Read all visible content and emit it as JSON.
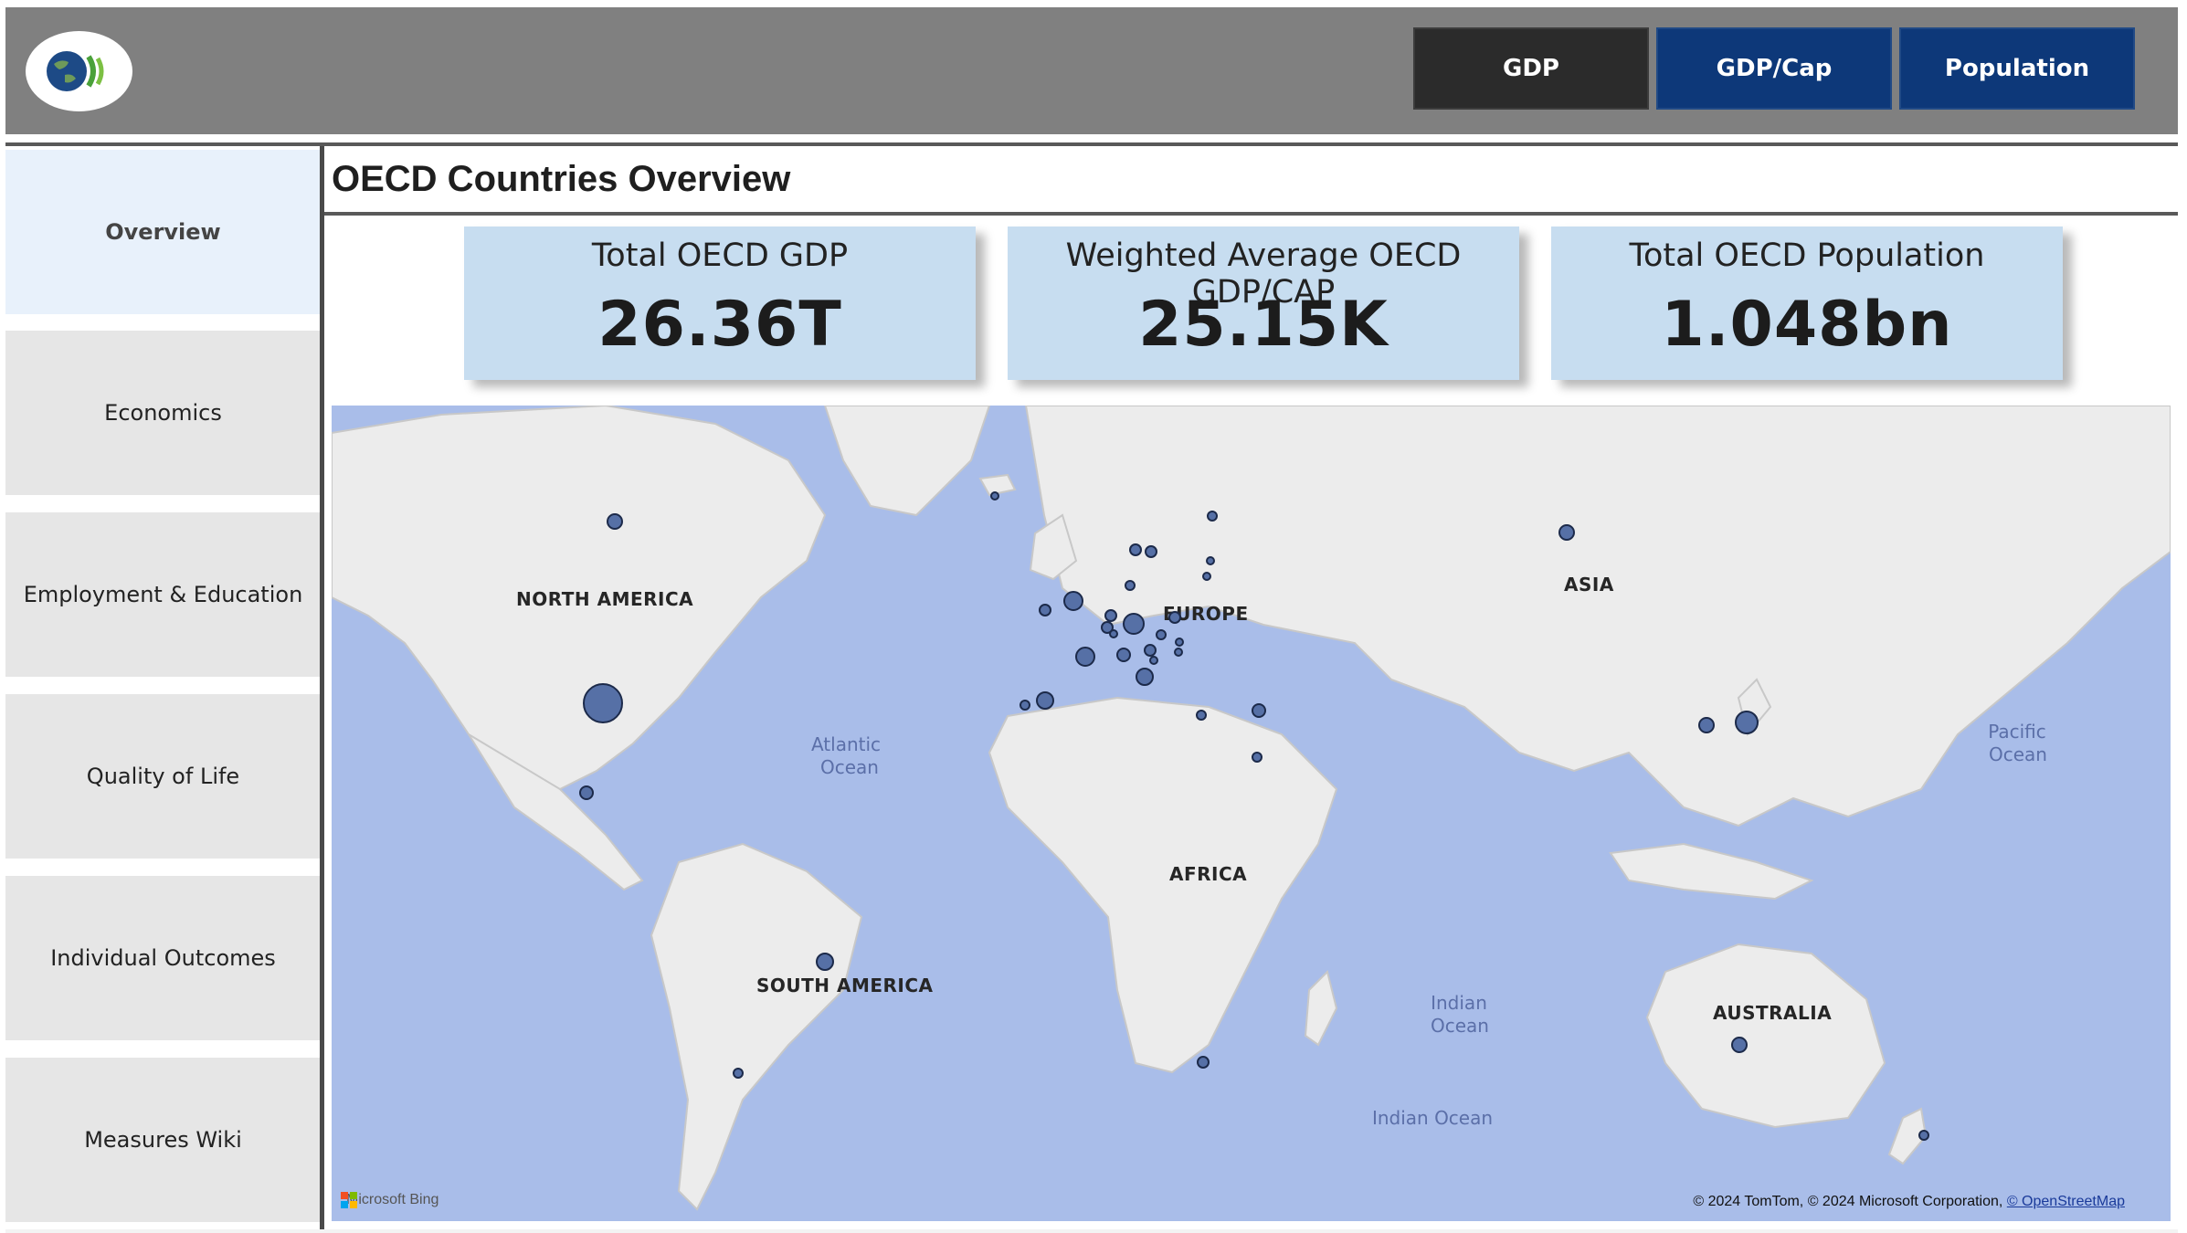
{
  "header": {
    "logo": {
      "icon": "oecd-globe-icon"
    },
    "buttons": [
      {
        "label": "GDP",
        "color": "#2b2b2b"
      },
      {
        "label": "GDP/Cap",
        "color": "#0d3879"
      },
      {
        "label": "Population",
        "color": "#0d3879"
      }
    ]
  },
  "sidebar": {
    "items": [
      {
        "label": "Overview",
        "active": true
      },
      {
        "label": "Economics",
        "active": false
      },
      {
        "label": "Employment & Education",
        "active": false
      },
      {
        "label": "Quality of Life",
        "active": false
      },
      {
        "label": "Individual Outcomes",
        "active": false
      },
      {
        "label": "Measures Wiki",
        "active": false
      }
    ]
  },
  "main": {
    "title": "OECD Countries Overview",
    "kpis": [
      {
        "label": "Total OECD GDP",
        "value": "26.36T"
      },
      {
        "label": "Weighted Average OECD GDP/CAP",
        "value": "25.15K"
      },
      {
        "label": "Total OECD Population",
        "value": "1.048bn"
      }
    ],
    "map": {
      "continent_labels": {
        "north_america": "NORTH AMERICA",
        "south_america": "SOUTH AMERICA",
        "europe": "EUROPE",
        "africa": "AFRICA",
        "asia": "ASIA",
        "australia": "AUSTRALIA"
      },
      "ocean_labels": {
        "atlantic": [
          "Atlantic",
          "Ocean"
        ],
        "pacific": [
          "Pacific",
          "Ocean"
        ],
        "indian": [
          "Indian",
          "Ocean"
        ],
        "indian_lower": "Indian Ocean"
      },
      "provider": "Microsoft Bing",
      "attribution": "© 2024 TomTom, © 2024 Microsoft Corporation,",
      "attribution_link": "© OpenStreetMap",
      "bubble_color": "#5670a6"
    }
  }
}
